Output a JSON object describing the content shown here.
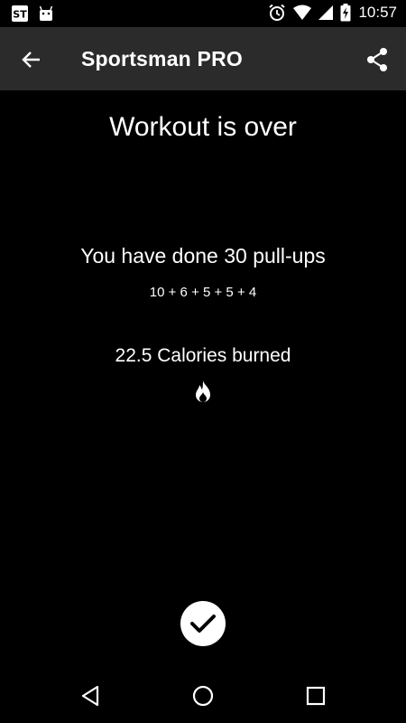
{
  "status_bar": {
    "time": "10:57",
    "icons_left": [
      "sportsman-app-icon",
      "android-icon"
    ],
    "icons_right": [
      "alarm-icon",
      "wifi-icon",
      "signal-icon",
      "battery-charging-icon"
    ]
  },
  "app_bar": {
    "title": "Sportsman PRO",
    "background": "#2b2b2b"
  },
  "workout": {
    "headline": "Workout is over",
    "summary": "You have done 30 pull-ups",
    "reps_breakdown": "10 + 6 + 5 + 5 + 4",
    "calories": "22.5 Calories burned"
  },
  "colors": {
    "background": "#000000",
    "text": "#ffffff"
  }
}
